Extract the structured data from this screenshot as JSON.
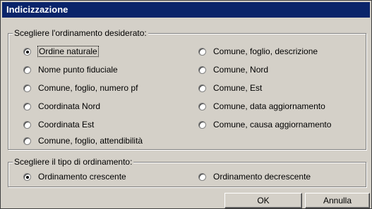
{
  "window": {
    "title": "Indicizzazione"
  },
  "ordering_group": {
    "legend": "Scegliere l'ordinamento desiderato:",
    "options": [
      {
        "label": "Ordine naturale",
        "checked": true
      },
      {
        "label": "Nome punto fiduciale",
        "checked": false
      },
      {
        "label": "Comune, foglio, numero pf",
        "checked": false
      },
      {
        "label": "Coordinata Nord",
        "checked": false
      },
      {
        "label": "Coordinata Est",
        "checked": false
      },
      {
        "label": "Comune, foglio, attendibilità",
        "checked": false
      },
      {
        "label": "Comune, foglio, descrizione",
        "checked": false
      },
      {
        "label": "Comune, Nord",
        "checked": false
      },
      {
        "label": "Comune, Est",
        "checked": false
      },
      {
        "label": "Comune, data aggiornamento",
        "checked": false
      },
      {
        "label": "Comune, causa aggiornamento",
        "checked": false
      }
    ]
  },
  "direction_group": {
    "legend": "Scegliere il tipo di ordinamento:",
    "options": [
      {
        "label": "Ordinamento crescente",
        "checked": true
      },
      {
        "label": "Ordinamento decrescente",
        "checked": false
      }
    ]
  },
  "buttons": {
    "ok": "OK",
    "cancel": "Annulla"
  }
}
